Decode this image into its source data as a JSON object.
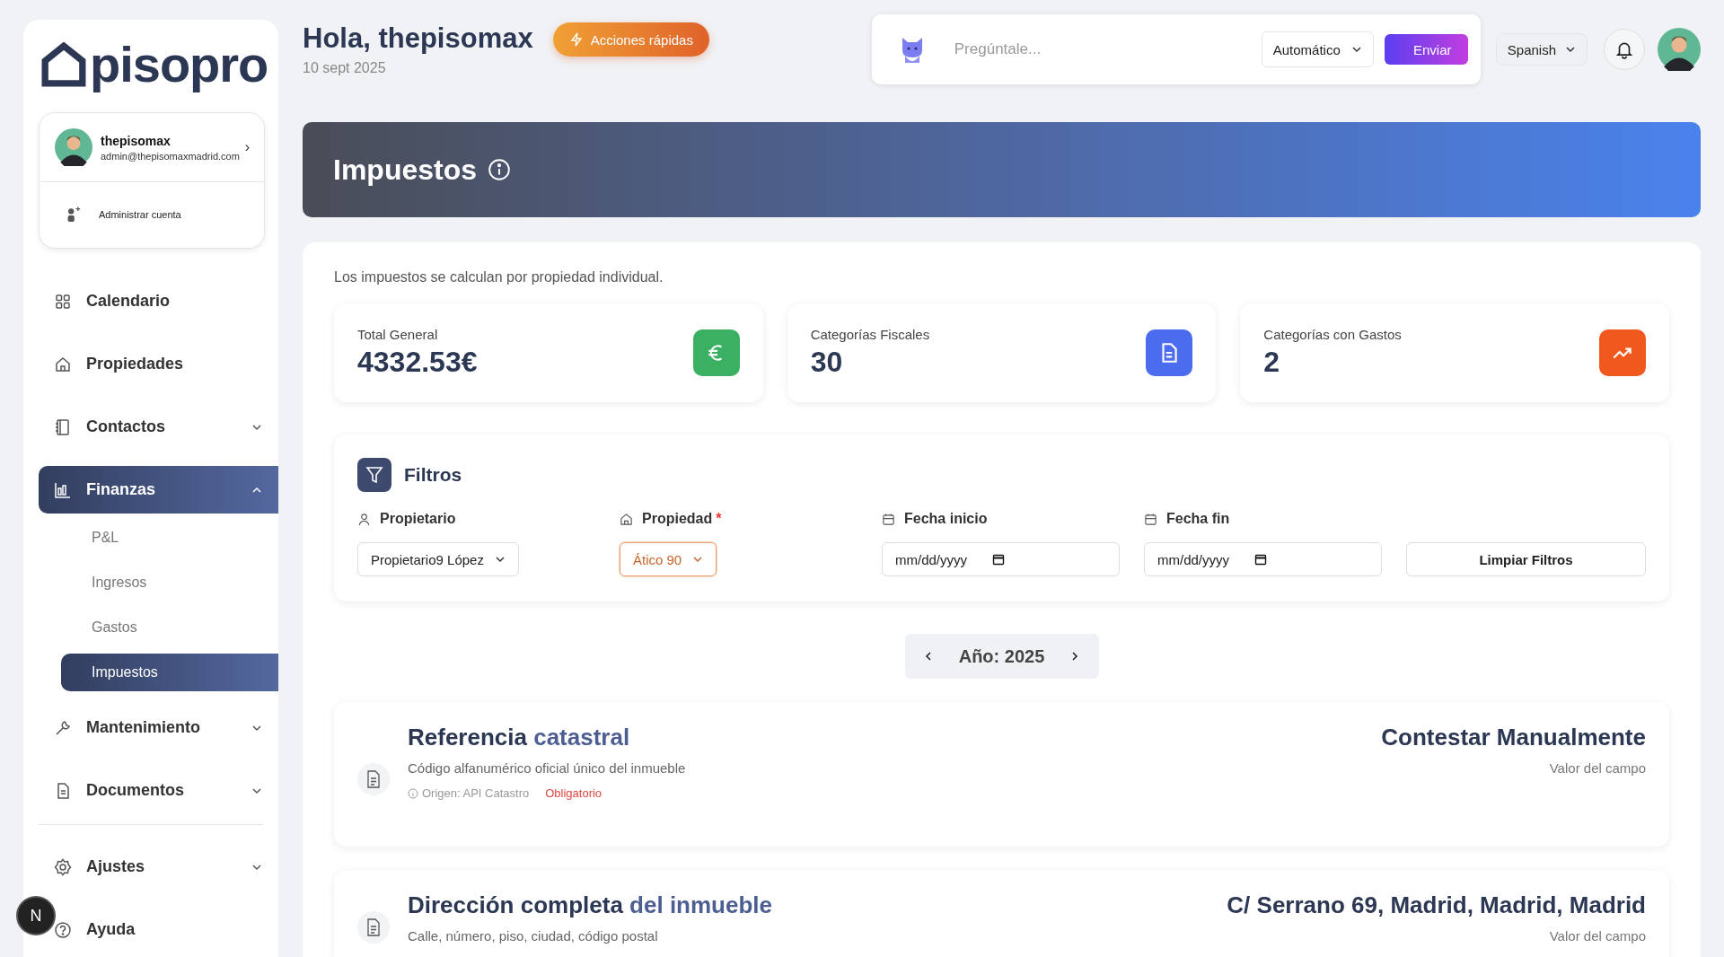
{
  "sidebar": {
    "logo": "pisopro",
    "account": {
      "name": "thepisomax",
      "email": "admin@thepisomaxmadrid.com",
      "chevron": "›",
      "manage": "Administrar cuenta"
    },
    "nav": [
      {
        "label": "Calendario",
        "selected": false
      },
      {
        "label": "Propiedades",
        "selected": false
      },
      {
        "label": "Contactos",
        "selected": false,
        "expanded": false
      },
      {
        "label": "Finanzas",
        "selected": true,
        "expanded": true,
        "children": [
          {
            "label": "P&L",
            "selected": false
          },
          {
            "label": "Ingresos",
            "selected": false
          },
          {
            "label": "Gastos",
            "selected": false
          },
          {
            "label": "Impuestos",
            "selected": true
          }
        ]
      },
      {
        "label": "Mantenimiento",
        "selected": false,
        "expanded": false
      },
      {
        "label": "Documentos",
        "selected": false,
        "expanded": false
      }
    ],
    "nav_footer": [
      {
        "label": "Ajustes",
        "selected": false,
        "expanded": false
      },
      {
        "label": "Ayuda",
        "selected": false
      }
    ],
    "badge": "N"
  },
  "header": {
    "greeting": "Hola, thepisomax",
    "date": "10 sept 2025",
    "quick_actions": "Acciones rápidas",
    "assistant": {
      "placeholder": "Pregúntale...",
      "mode": "Automático",
      "send": "Enviar"
    },
    "language": "Spanish"
  },
  "banner": {
    "title": "Impuestos"
  },
  "intro": "Los impuestos se calculan por propiedad individual.",
  "stats": [
    {
      "label": "Total General",
      "value": "4332.53€",
      "color": "#3bb062",
      "kind": "euro"
    },
    {
      "label": "Categorías Fiscales",
      "value": "30",
      "color": "#4c6cf0",
      "kind": "document"
    },
    {
      "label": "Categorías con Gastos",
      "value": "2",
      "color": "#f0581e",
      "kind": "trend"
    }
  ],
  "filters": {
    "title": "Filtros",
    "fields": [
      {
        "kind": "select",
        "label": "Propietario",
        "value": "Propietario9 López",
        "focused": false
      },
      {
        "kind": "select",
        "label": "Propiedad",
        "required_mark": "*",
        "value": "Ático 90",
        "focused": true
      },
      {
        "kind": "date",
        "label": "Fecha inicio",
        "value": "mm/dd/yyyy"
      },
      {
        "kind": "date",
        "label": "Fecha fin",
        "value": "mm/dd/yyyy"
      }
    ],
    "clear": "Limpiar Filtros"
  },
  "year_nav": {
    "label": "Año: 2025"
  },
  "fields": [
    {
      "title_lead": "Referencia",
      "title_tail": "catastral",
      "description": "Código alfanumérico oficial único del inmueble",
      "origin": "Origen: API Catastro",
      "tag": "Obligatorio",
      "value": "Contestar Manualmente",
      "value_caption": "Valor del campo"
    },
    {
      "title_lead": "Dirección completa",
      "title_tail": "del inmueble",
      "description": "Calle, número, piso, ciudad, código postal",
      "value": "C/ Serrano 69, Madrid, Madrid, Madrid",
      "value_caption": "Valor del campo"
    }
  ]
}
